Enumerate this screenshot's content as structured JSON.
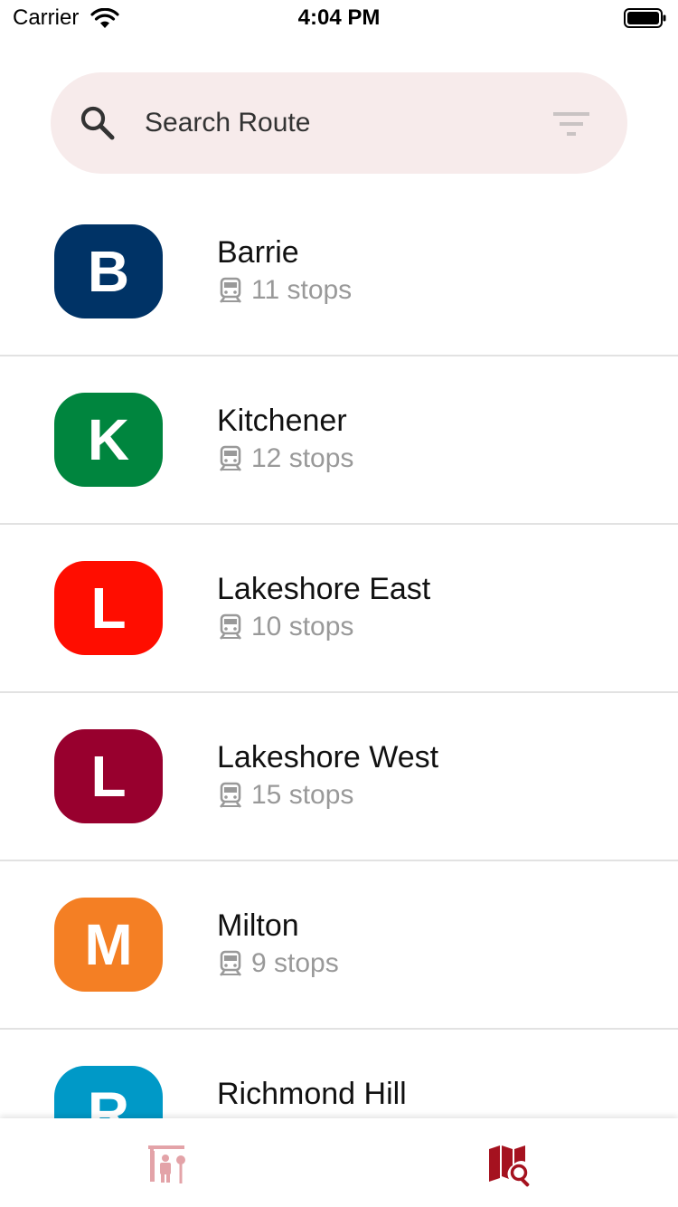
{
  "status_bar": {
    "carrier": "Carrier",
    "time": "4:04 PM"
  },
  "search": {
    "placeholder": "Search Route",
    "value": ""
  },
  "routes": [
    {
      "letter": "B",
      "name": "Barrie",
      "stops": "11 stops",
      "color": "#003366"
    },
    {
      "letter": "K",
      "name": "Kitchener",
      "stops": "12 stops",
      "color": "#00853e"
    },
    {
      "letter": "L",
      "name": "Lakeshore East",
      "stops": "10 stops",
      "color": "#ff0d00"
    },
    {
      "letter": "L",
      "name": "Lakeshore West",
      "stops": "15 stops",
      "color": "#98002e"
    },
    {
      "letter": "M",
      "name": "Milton",
      "stops": "9 stops",
      "color": "#f47f24"
    },
    {
      "letter": "R",
      "name": "Richmond Hill",
      "stops": "",
      "color": "#0099c7"
    }
  ],
  "tab_bar": {
    "tabs": [
      {
        "icon": "station-icon",
        "active": false,
        "color": "#e3a3a8"
      },
      {
        "icon": "map-search-icon",
        "active": true,
        "color": "#a5121f"
      }
    ]
  },
  "icons": {
    "stop_icon": "train-icon"
  }
}
